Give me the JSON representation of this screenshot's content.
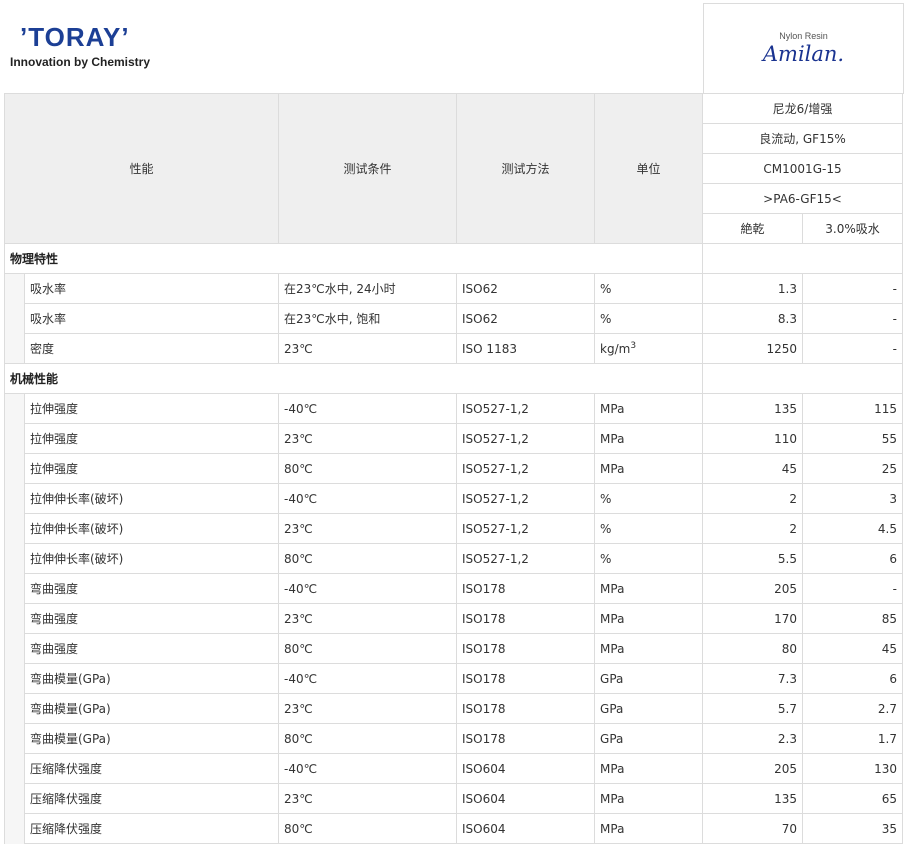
{
  "logo": {
    "brand": "’TORAY’",
    "tagline": "Innovation by Chemistry"
  },
  "product": {
    "subtitle": "Nylon Resin",
    "name": "Amilan."
  },
  "header": {
    "col_property": "性能",
    "col_condition": "测试条件",
    "col_method": "测试方法",
    "col_unit": "单位",
    "material_lines": [
      "尼龙6/增强",
      "良流动, GF15%",
      "CM1001G-15",
      ">PA6-GF15<"
    ],
    "state_dry": "絶乾",
    "state_wet": "3.0%吸水"
  },
  "sections": [
    {
      "title": "物理特性",
      "rows": [
        {
          "property": "吸水率",
          "condition": "在23℃水中, 24小时",
          "method": "ISO62",
          "unit": "%",
          "dry": "1.3",
          "wet": "-"
        },
        {
          "property": "吸水率",
          "condition": "在23℃水中, 饱和",
          "method": "ISO62",
          "unit": "%",
          "dry": "8.3",
          "wet": "-"
        },
        {
          "property": "密度",
          "condition": "23℃",
          "method": "ISO 1183",
          "unit": "kg/m",
          "unit_sup": "3",
          "dry": "1250",
          "wet": "-"
        }
      ]
    },
    {
      "title": "机械性能",
      "rows": [
        {
          "property": "拉伸强度",
          "condition": "-40℃",
          "method": "ISO527-1,2",
          "unit": "MPa",
          "dry": "135",
          "wet": "115"
        },
        {
          "property": "拉伸强度",
          "condition": "23℃",
          "method": "ISO527-1,2",
          "unit": "MPa",
          "dry": "110",
          "wet": "55"
        },
        {
          "property": "拉伸强度",
          "condition": "80℃",
          "method": "ISO527-1,2",
          "unit": "MPa",
          "dry": "45",
          "wet": "25"
        },
        {
          "property": "拉伸伸长率(破坏)",
          "condition": "-40℃",
          "method": "ISO527-1,2",
          "unit": "%",
          "dry": "2",
          "wet": "3"
        },
        {
          "property": "拉伸伸长率(破坏)",
          "condition": "23℃",
          "method": "ISO527-1,2",
          "unit": "%",
          "dry": "2",
          "wet": "4.5"
        },
        {
          "property": "拉伸伸长率(破坏)",
          "condition": "80℃",
          "method": "ISO527-1,2",
          "unit": "%",
          "dry": "5.5",
          "wet": "6"
        },
        {
          "property": "弯曲强度",
          "condition": "-40℃",
          "method": "ISO178",
          "unit": "MPa",
          "dry": "205",
          "wet": "-"
        },
        {
          "property": "弯曲强度",
          "condition": "23℃",
          "method": "ISO178",
          "unit": "MPa",
          "dry": "170",
          "wet": "85"
        },
        {
          "property": "弯曲强度",
          "condition": "80℃",
          "method": "ISO178",
          "unit": "MPa",
          "dry": "80",
          "wet": "45"
        },
        {
          "property": "弯曲模量(GPa)",
          "condition": "-40℃",
          "method": "ISO178",
          "unit": "GPa",
          "dry": "7.3",
          "wet": "6"
        },
        {
          "property": "弯曲模量(GPa)",
          "condition": "23℃",
          "method": "ISO178",
          "unit": "GPa",
          "dry": "5.7",
          "wet": "2.7"
        },
        {
          "property": "弯曲模量(GPa)",
          "condition": "80℃",
          "method": "ISO178",
          "unit": "GPa",
          "dry": "2.3",
          "wet": "1.7"
        },
        {
          "property": "压缩降伏强度",
          "condition": "-40℃",
          "method": "ISO604",
          "unit": "MPa",
          "dry": "205",
          "wet": "130"
        },
        {
          "property": "压缩降伏强度",
          "condition": "23℃",
          "method": "ISO604",
          "unit": "MPa",
          "dry": "135",
          "wet": "65"
        },
        {
          "property": "压缩降伏强度",
          "condition": "80℃",
          "method": "ISO604",
          "unit": "MPa",
          "dry": "70",
          "wet": "35"
        }
      ]
    }
  ]
}
